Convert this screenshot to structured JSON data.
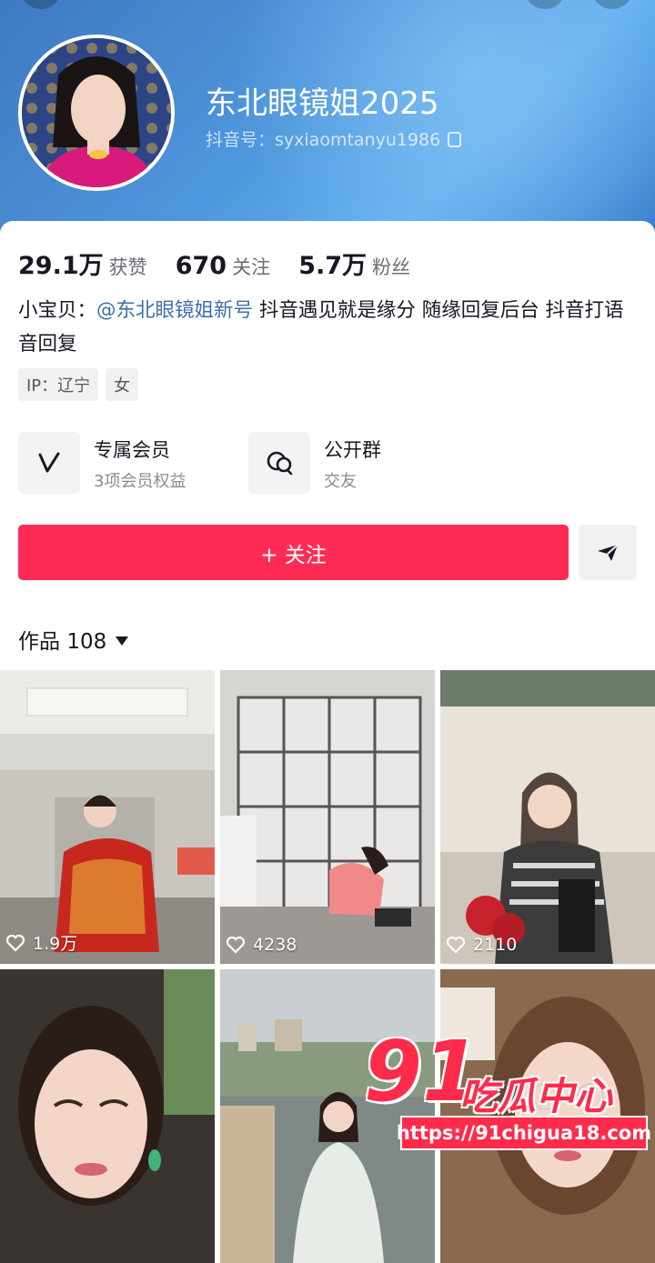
{
  "profile": {
    "name": "东北眼镜姐2025",
    "douyin_id_label": "抖音号：",
    "douyin_id": "syxiaomtanyu1986"
  },
  "stats": [
    {
      "value": "29.1万",
      "label": "获赞"
    },
    {
      "value": "670",
      "label": "关注"
    },
    {
      "value": "5.7万",
      "label": "粉丝"
    }
  ],
  "bio": {
    "prefix": "小宝贝：",
    "mention": "@东北眼镜姐新号",
    "text": " 抖音遇见就是缘分 随缘回复后台 抖音打语音回复"
  },
  "tags": [
    "IP：辽宁",
    "女"
  ],
  "entries": [
    {
      "title": "专属会员",
      "subtitle": "3项会员权益",
      "icon": "vip-v-icon"
    },
    {
      "title": "公开群",
      "subtitle": "交友",
      "icon": "group-chat-icon"
    }
  ],
  "actions": {
    "follow_label": "+ 关注",
    "share_icon": "send-icon"
  },
  "works": {
    "label": "作品",
    "count": "108"
  },
  "videos": [
    {
      "likes": "1.9万"
    },
    {
      "likes": "4238"
    },
    {
      "likes": "2110"
    },
    {
      "likes": ""
    },
    {
      "likes": ""
    },
    {
      "likes": ""
    }
  ],
  "watermark": {
    "number": "91",
    "text": "吃瓜中心",
    "url": "https://91chigua18.com"
  },
  "colors": {
    "accent": "#fe2c55",
    "header_blue": "#4f97dc",
    "mention": "#3f6ea8"
  }
}
